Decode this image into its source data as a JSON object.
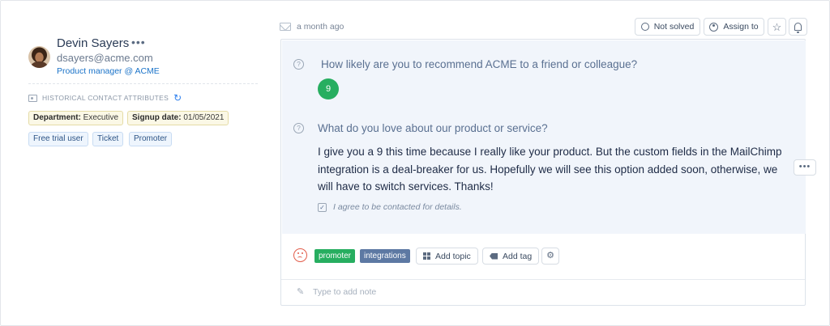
{
  "contact": {
    "name": "Devin Sayers",
    "email": "dsayers@acme.com",
    "role": "Product manager @ ACME",
    "more_icon": "more-horizontal-icon",
    "historical_label": "HISTORICAL CONTACT ATTRIBUTES",
    "attributes": [
      {
        "key": "Department:",
        "value": " Executive"
      },
      {
        "key": "Signup date:",
        "value": " 01/05/2021"
      }
    ],
    "tags": [
      "Free trial user",
      "Ticket",
      "Promoter"
    ]
  },
  "response": {
    "time_ago": "a month ago",
    "header_buttons": {
      "status_label": "Not solved",
      "assign_label": "Assign to"
    },
    "question_1": "How likely are you to recommend ACME to a friend or colleague?",
    "score": "9",
    "question_2": "What do you love about our product or service?",
    "answer": "I give you a 9 this time because I really like your product. But the custom fields in the MailChimp integration is a deal-breaker for us. Hopefully we will see this option added soon, otherwise, we will have to switch services. Thanks!",
    "agree_text": "I agree to be contacted for details.",
    "topics": [
      "promoter",
      "integrations"
    ],
    "add_topic_label": "Add topic",
    "add_tag_label": "Add tag",
    "note_placeholder": "Type to add note"
  },
  "colors": {
    "score_green": "#27ae60",
    "tag_green": "#27ae60",
    "tag_slate": "#5d79a3",
    "link_blue": "#1a73c9",
    "sentiment_red": "#e25c4a"
  }
}
